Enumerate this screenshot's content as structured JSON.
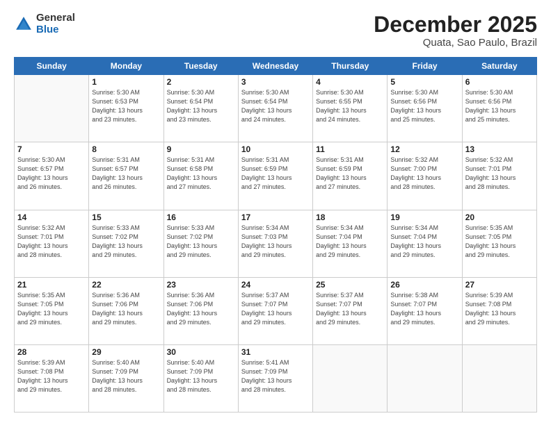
{
  "header": {
    "logo_general": "General",
    "logo_blue": "Blue",
    "month": "December 2025",
    "location": "Quata, Sao Paulo, Brazil"
  },
  "weekdays": [
    "Sunday",
    "Monday",
    "Tuesday",
    "Wednesday",
    "Thursday",
    "Friday",
    "Saturday"
  ],
  "weeks": [
    [
      {
        "day": "",
        "info": ""
      },
      {
        "day": "1",
        "info": "Sunrise: 5:30 AM\nSunset: 6:53 PM\nDaylight: 13 hours\nand 23 minutes."
      },
      {
        "day": "2",
        "info": "Sunrise: 5:30 AM\nSunset: 6:54 PM\nDaylight: 13 hours\nand 23 minutes."
      },
      {
        "day": "3",
        "info": "Sunrise: 5:30 AM\nSunset: 6:54 PM\nDaylight: 13 hours\nand 24 minutes."
      },
      {
        "day": "4",
        "info": "Sunrise: 5:30 AM\nSunset: 6:55 PM\nDaylight: 13 hours\nand 24 minutes."
      },
      {
        "day": "5",
        "info": "Sunrise: 5:30 AM\nSunset: 6:56 PM\nDaylight: 13 hours\nand 25 minutes."
      },
      {
        "day": "6",
        "info": "Sunrise: 5:30 AM\nSunset: 6:56 PM\nDaylight: 13 hours\nand 25 minutes."
      }
    ],
    [
      {
        "day": "7",
        "info": "Sunrise: 5:30 AM\nSunset: 6:57 PM\nDaylight: 13 hours\nand 26 minutes."
      },
      {
        "day": "8",
        "info": "Sunrise: 5:31 AM\nSunset: 6:57 PM\nDaylight: 13 hours\nand 26 minutes."
      },
      {
        "day": "9",
        "info": "Sunrise: 5:31 AM\nSunset: 6:58 PM\nDaylight: 13 hours\nand 27 minutes."
      },
      {
        "day": "10",
        "info": "Sunrise: 5:31 AM\nSunset: 6:59 PM\nDaylight: 13 hours\nand 27 minutes."
      },
      {
        "day": "11",
        "info": "Sunrise: 5:31 AM\nSunset: 6:59 PM\nDaylight: 13 hours\nand 27 minutes."
      },
      {
        "day": "12",
        "info": "Sunrise: 5:32 AM\nSunset: 7:00 PM\nDaylight: 13 hours\nand 28 minutes."
      },
      {
        "day": "13",
        "info": "Sunrise: 5:32 AM\nSunset: 7:01 PM\nDaylight: 13 hours\nand 28 minutes."
      }
    ],
    [
      {
        "day": "14",
        "info": "Sunrise: 5:32 AM\nSunset: 7:01 PM\nDaylight: 13 hours\nand 28 minutes."
      },
      {
        "day": "15",
        "info": "Sunrise: 5:33 AM\nSunset: 7:02 PM\nDaylight: 13 hours\nand 29 minutes."
      },
      {
        "day": "16",
        "info": "Sunrise: 5:33 AM\nSunset: 7:02 PM\nDaylight: 13 hours\nand 29 minutes."
      },
      {
        "day": "17",
        "info": "Sunrise: 5:34 AM\nSunset: 7:03 PM\nDaylight: 13 hours\nand 29 minutes."
      },
      {
        "day": "18",
        "info": "Sunrise: 5:34 AM\nSunset: 7:04 PM\nDaylight: 13 hours\nand 29 minutes."
      },
      {
        "day": "19",
        "info": "Sunrise: 5:34 AM\nSunset: 7:04 PM\nDaylight: 13 hours\nand 29 minutes."
      },
      {
        "day": "20",
        "info": "Sunrise: 5:35 AM\nSunset: 7:05 PM\nDaylight: 13 hours\nand 29 minutes."
      }
    ],
    [
      {
        "day": "21",
        "info": "Sunrise: 5:35 AM\nSunset: 7:05 PM\nDaylight: 13 hours\nand 29 minutes."
      },
      {
        "day": "22",
        "info": "Sunrise: 5:36 AM\nSunset: 7:06 PM\nDaylight: 13 hours\nand 29 minutes."
      },
      {
        "day": "23",
        "info": "Sunrise: 5:36 AM\nSunset: 7:06 PM\nDaylight: 13 hours\nand 29 minutes."
      },
      {
        "day": "24",
        "info": "Sunrise: 5:37 AM\nSunset: 7:07 PM\nDaylight: 13 hours\nand 29 minutes."
      },
      {
        "day": "25",
        "info": "Sunrise: 5:37 AM\nSunset: 7:07 PM\nDaylight: 13 hours\nand 29 minutes."
      },
      {
        "day": "26",
        "info": "Sunrise: 5:38 AM\nSunset: 7:07 PM\nDaylight: 13 hours\nand 29 minutes."
      },
      {
        "day": "27",
        "info": "Sunrise: 5:39 AM\nSunset: 7:08 PM\nDaylight: 13 hours\nand 29 minutes."
      }
    ],
    [
      {
        "day": "28",
        "info": "Sunrise: 5:39 AM\nSunset: 7:08 PM\nDaylight: 13 hours\nand 29 minutes."
      },
      {
        "day": "29",
        "info": "Sunrise: 5:40 AM\nSunset: 7:09 PM\nDaylight: 13 hours\nand 28 minutes."
      },
      {
        "day": "30",
        "info": "Sunrise: 5:40 AM\nSunset: 7:09 PM\nDaylight: 13 hours\nand 28 minutes."
      },
      {
        "day": "31",
        "info": "Sunrise: 5:41 AM\nSunset: 7:09 PM\nDaylight: 13 hours\nand 28 minutes."
      },
      {
        "day": "",
        "info": ""
      },
      {
        "day": "",
        "info": ""
      },
      {
        "day": "",
        "info": ""
      }
    ]
  ]
}
